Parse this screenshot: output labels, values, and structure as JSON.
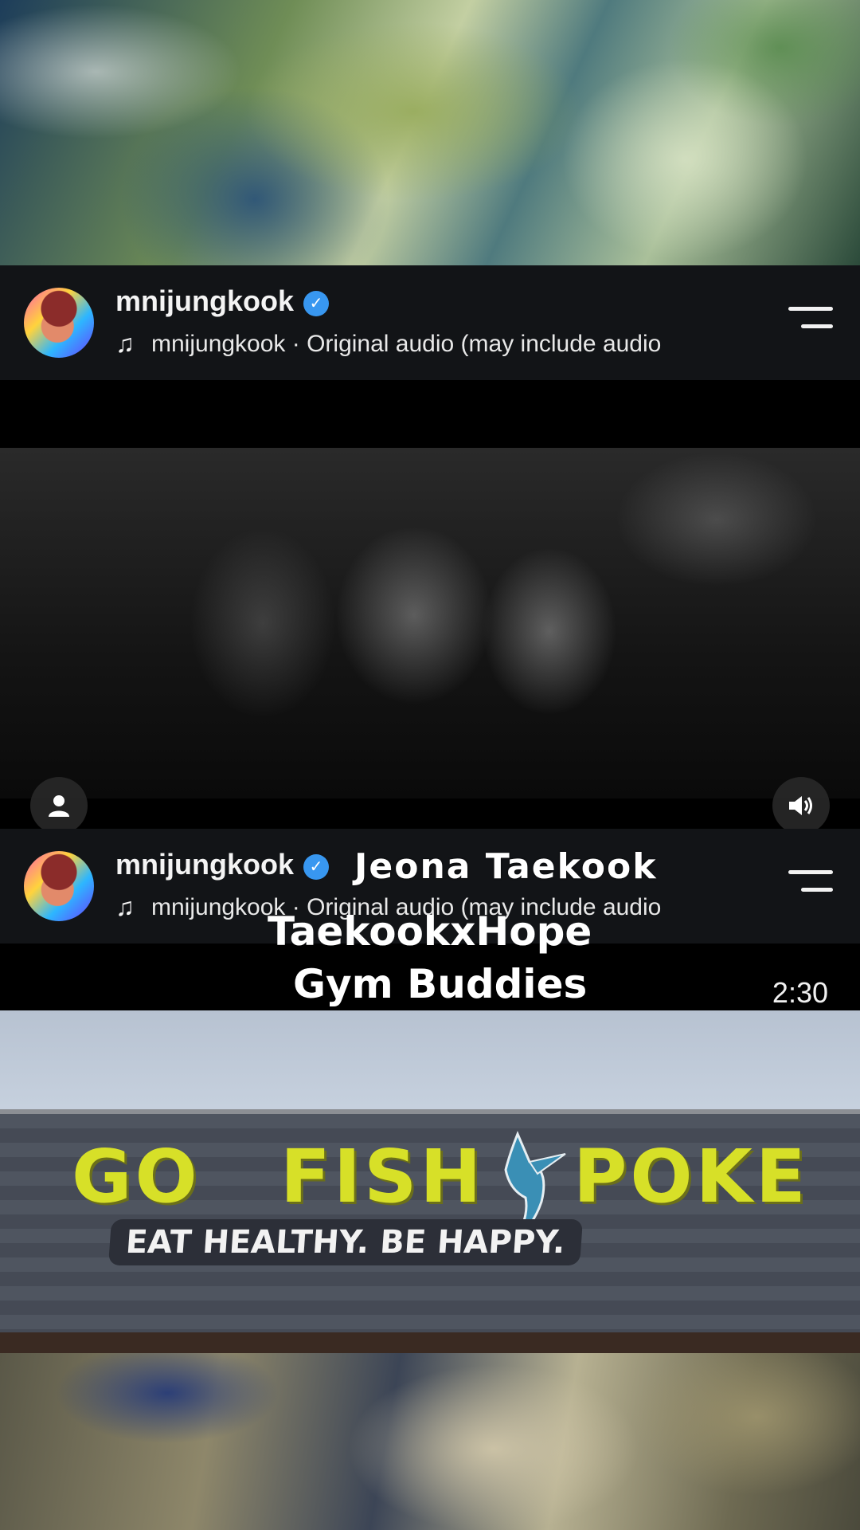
{
  "posts": [
    {
      "username": "mnijungkook",
      "verified_mark": "✓",
      "audio_icon": "music-note-icon",
      "audio_text": "mnijungkook · Original audio  (may include audio"
    },
    {
      "username": "mnijungkook",
      "verified_mark": "✓",
      "audio_icon": "music-note-icon",
      "audio_text": "mnijungkook · Original audio  (may include audio"
    }
  ],
  "video": {
    "profile_icon": "person-icon",
    "volume_icon": "speaker-icon"
  },
  "overlay": {
    "watermark": "Jeona Taekook",
    "line1": "TaekookxHope",
    "line2": "Gym Buddies",
    "duration": "2:30"
  },
  "photo_sign": {
    "word1": "GO",
    "word2": "FISH",
    "word3": "POKE",
    "slogan": "EAT HEALTHY. BE HAPPY."
  },
  "colors": {
    "header_bg": "#121417",
    "verified_blue": "#3897f0",
    "sign_yellow": "#d7e028"
  }
}
